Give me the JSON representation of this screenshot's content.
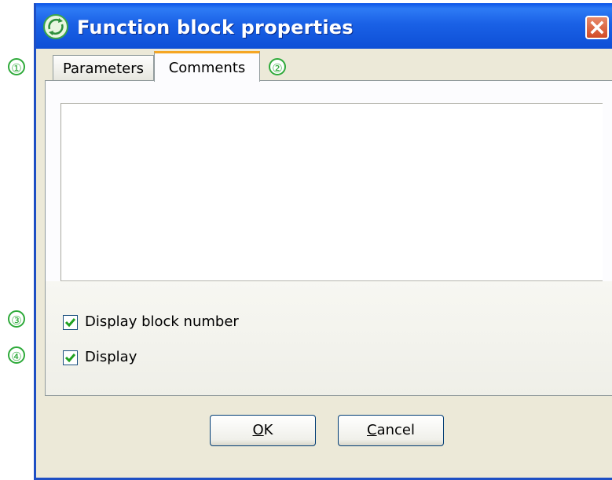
{
  "window": {
    "title": "Function block properties"
  },
  "tabs": [
    {
      "label": "Parameters",
      "active": false
    },
    {
      "label": "Comments",
      "active": true
    }
  ],
  "comments": {
    "value": ""
  },
  "checkboxes": [
    {
      "label": "Display block number",
      "checked": true
    },
    {
      "label": "Display",
      "checked": true
    }
  ],
  "buttons": {
    "ok_first": "O",
    "ok_rest": "K",
    "cancel_first": "C",
    "cancel_rest": "ancel"
  },
  "callouts": [
    "①",
    "②",
    "③",
    "④"
  ],
  "colors": {
    "titlebar": "#0d4fd6",
    "callout": "#2eaa3a",
    "tab_accent": "#f5a623",
    "checkmark": "#21a121"
  }
}
